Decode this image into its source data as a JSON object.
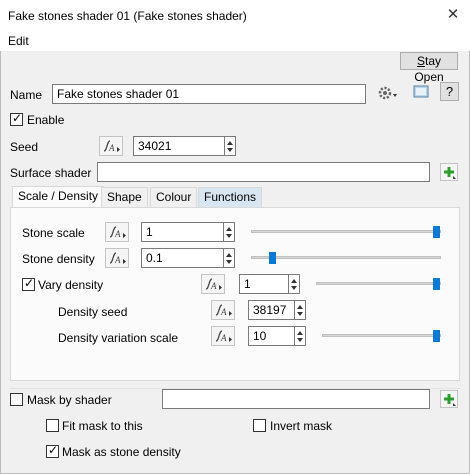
{
  "window": {
    "title": "Fake stones shader 01     (Fake stones shader)",
    "close_glyph": "✕"
  },
  "menu": {
    "items": [
      "Edit"
    ]
  },
  "toolbar": {
    "stay_open_label_mn": "S",
    "stay_open_label_rest": "tay Open",
    "help_glyph": "?"
  },
  "name": {
    "label": "Name",
    "value": "Fake stones shader 01"
  },
  "enable": {
    "label": "Enable",
    "checked": true
  },
  "seed": {
    "label": "Seed",
    "value": "34021"
  },
  "surface_shader": {
    "label": "Surface shader",
    "value": ""
  },
  "tabs": [
    {
      "label": "Scale / Density",
      "active": true
    },
    {
      "label": "Shape",
      "active": false
    },
    {
      "label": "Colour",
      "active": false
    },
    {
      "label": "Functions",
      "active": false
    }
  ],
  "scale_density": {
    "stone_scale": {
      "label": "Stone scale",
      "value": "1",
      "slider": 1.0
    },
    "stone_density": {
      "label": "Stone density",
      "value": "0.1",
      "slider": 0.1
    },
    "vary_density": {
      "label": "Vary density",
      "checked": true,
      "value": "1",
      "slider": 1.0
    },
    "density_seed": {
      "label": "Density seed",
      "value": "38197"
    },
    "density_variation_scale": {
      "label": "Density variation scale",
      "value": "10",
      "slider": 1.0
    }
  },
  "mask": {
    "mask_by_shader": {
      "label": "Mask by shader",
      "checked": false,
      "value": ""
    },
    "fit_mask": {
      "label": "Fit mask to this",
      "checked": false
    },
    "invert_mask": {
      "label": "Invert mask",
      "checked": false
    },
    "mask_as_density": {
      "label": "Mask as stone density",
      "checked": true
    }
  },
  "icons": {
    "gear": "gear-icon",
    "preview": "preview-icon",
    "help": "help-icon",
    "func": "function-icon",
    "plus": "add-icon"
  },
  "colors": {
    "accent": "#0a7ad5",
    "plus": "#2e9e2e",
    "tab_highlight": "#d8e6f2"
  }
}
